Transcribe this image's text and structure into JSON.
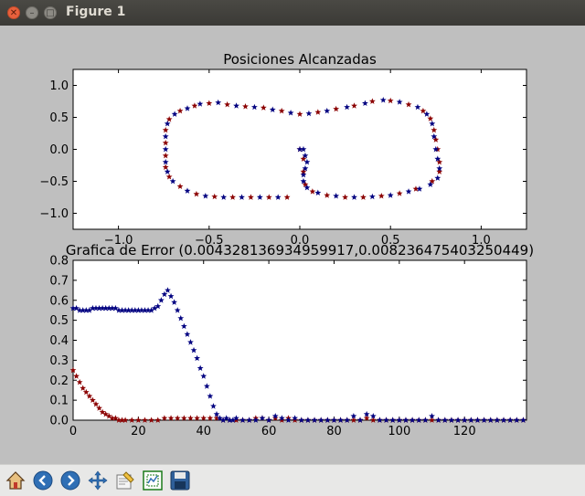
{
  "window": {
    "title": "Figure 1"
  },
  "toolbar": {
    "buttons": [
      {
        "name": "home-icon",
        "tooltip": ""
      },
      {
        "name": "back-icon",
        "tooltip": ""
      },
      {
        "name": "forward-icon",
        "tooltip": ""
      },
      {
        "name": "pan-icon",
        "tooltip": ""
      },
      {
        "name": "zoom-icon",
        "tooltip": ""
      },
      {
        "name": "subplots-icon",
        "tooltip": ""
      },
      {
        "name": "save-icon",
        "tooltip": ""
      }
    ]
  },
  "colors": {
    "series_blue": "#000080",
    "series_red": "#8b0000",
    "background": "#bfbfbf",
    "axes_bg": "#ffffff"
  },
  "chart_data": [
    {
      "type": "scatter",
      "title": "Posiciones Alcanzadas",
      "xlabel": "",
      "ylabel": "",
      "xlim": [
        -1.25,
        1.25
      ],
      "ylim": [
        -1.25,
        1.25
      ],
      "xticks": [
        "−1.0",
        "−0.5",
        "0.0",
        "0.5",
        "1.0"
      ],
      "yticks": [
        "1.0",
        "0.5",
        "0.0",
        "−0.5",
        "−1.0"
      ],
      "grid": false,
      "marker": "star",
      "series": [
        {
          "color": "#000080",
          "points": [
            [
              0.0,
              0.0
            ],
            [
              0.02,
              0.0
            ],
            [
              0.03,
              -0.1
            ],
            [
              0.04,
              -0.2
            ],
            [
              0.03,
              -0.3
            ],
            [
              0.02,
              -0.4
            ],
            [
              0.02,
              -0.5
            ],
            [
              0.04,
              -0.6
            ],
            [
              0.1,
              -0.68
            ],
            [
              0.2,
              -0.73
            ],
            [
              0.3,
              -0.75
            ],
            [
              0.4,
              -0.74
            ],
            [
              0.5,
              -0.72
            ],
            [
              0.6,
              -0.66
            ],
            [
              0.66,
              -0.62
            ],
            [
              0.72,
              -0.55
            ],
            [
              0.76,
              -0.45
            ],
            [
              0.77,
              -0.3
            ],
            [
              0.76,
              -0.15
            ],
            [
              0.75,
              0.0
            ],
            [
              0.74,
              0.2
            ],
            [
              0.73,
              0.4
            ],
            [
              0.7,
              0.55
            ],
            [
              0.65,
              0.66
            ],
            [
              0.55,
              0.74
            ],
            [
              0.46,
              0.77
            ],
            [
              0.36,
              0.72
            ],
            [
              0.26,
              0.66
            ],
            [
              0.15,
              0.6
            ],
            [
              0.05,
              0.56
            ],
            [
              -0.05,
              0.57
            ],
            [
              -0.15,
              0.62
            ],
            [
              -0.25,
              0.66
            ],
            [
              -0.35,
              0.68
            ],
            [
              -0.45,
              0.73
            ],
            [
              -0.55,
              0.71
            ],
            [
              -0.62,
              0.64
            ],
            [
              -0.69,
              0.55
            ],
            [
              -0.73,
              0.4
            ],
            [
              -0.74,
              0.2
            ],
            [
              -0.74,
              0.0
            ],
            [
              -0.74,
              -0.2
            ],
            [
              -0.73,
              -0.35
            ],
            [
              -0.7,
              -0.5
            ],
            [
              -0.62,
              -0.65
            ],
            [
              -0.52,
              -0.73
            ],
            [
              -0.42,
              -0.75
            ],
            [
              -0.32,
              -0.75
            ],
            [
              -0.22,
              -0.75
            ],
            [
              -0.12,
              -0.75
            ]
          ]
        },
        {
          "color": "#8b0000",
          "points": [
            [
              0.0,
              0.0
            ],
            [
              0.02,
              -0.15
            ],
            [
              0.02,
              -0.35
            ],
            [
              0.03,
              -0.55
            ],
            [
              0.07,
              -0.66
            ],
            [
              0.15,
              -0.72
            ],
            [
              0.25,
              -0.75
            ],
            [
              0.35,
              -0.75
            ],
            [
              0.45,
              -0.73
            ],
            [
              0.55,
              -0.69
            ],
            [
              0.64,
              -0.62
            ],
            [
              0.73,
              -0.5
            ],
            [
              0.77,
              -0.35
            ],
            [
              0.77,
              -0.2
            ],
            [
              0.76,
              0.0
            ],
            [
              0.75,
              0.15
            ],
            [
              0.74,
              0.3
            ],
            [
              0.72,
              0.48
            ],
            [
              0.68,
              0.6
            ],
            [
              0.6,
              0.7
            ],
            [
              0.5,
              0.76
            ],
            [
              0.4,
              0.75
            ],
            [
              0.3,
              0.68
            ],
            [
              0.2,
              0.63
            ],
            [
              0.1,
              0.58
            ],
            [
              0.0,
              0.55
            ],
            [
              -0.1,
              0.6
            ],
            [
              -0.2,
              0.65
            ],
            [
              -0.3,
              0.67
            ],
            [
              -0.4,
              0.7
            ],
            [
              -0.5,
              0.72
            ],
            [
              -0.58,
              0.68
            ],
            [
              -0.66,
              0.6
            ],
            [
              -0.72,
              0.47
            ],
            [
              -0.74,
              0.3
            ],
            [
              -0.74,
              0.1
            ],
            [
              -0.74,
              -0.1
            ],
            [
              -0.74,
              -0.28
            ],
            [
              -0.72,
              -0.43
            ],
            [
              -0.66,
              -0.58
            ],
            [
              -0.57,
              -0.7
            ],
            [
              -0.47,
              -0.74
            ],
            [
              -0.37,
              -0.75
            ],
            [
              -0.27,
              -0.75
            ],
            [
              -0.17,
              -0.75
            ],
            [
              -0.07,
              -0.75
            ]
          ]
        }
      ]
    },
    {
      "type": "scatter",
      "title": "Grafica de Error (0.00432813693495991­7,0.00823647540325044­9)",
      "title_display": "Grafica de Error (0.004328136934959917,0.008236475403250449)",
      "xlabel": "",
      "ylabel": "",
      "xlim": [
        0,
        139
      ],
      "ylim": [
        0.0,
        0.8
      ],
      "xticks": [
        "0",
        "20",
        "40",
        "60",
        "80",
        "100",
        "120"
      ],
      "yticks": [
        "0.8",
        "0.7",
        "0.6",
        "0.5",
        "0.4",
        "0.3",
        "0.2",
        "0.1",
        "0.0"
      ],
      "grid": false,
      "marker": "star",
      "series": [
        {
          "color": "#000080",
          "x": [
            0,
            1,
            2,
            3,
            4,
            5,
            6,
            7,
            8,
            9,
            10,
            11,
            12,
            13,
            14,
            15,
            16,
            17,
            18,
            19,
            20,
            21,
            22,
            23,
            24,
            25,
            26,
            27,
            28,
            29,
            30,
            31,
            32,
            33,
            34,
            35,
            36,
            37,
            38,
            39,
            40,
            41,
            42,
            43,
            44,
            45,
            46,
            47,
            48,
            49,
            50,
            52,
            54,
            56,
            58,
            60,
            62,
            64,
            66,
            68,
            70,
            72,
            74,
            76,
            78,
            80,
            82,
            84,
            86,
            88,
            90,
            92,
            94,
            96,
            98,
            100,
            102,
            104,
            106,
            108,
            110,
            112,
            114,
            116,
            118,
            120,
            122,
            124,
            126,
            128,
            130,
            132,
            134,
            136,
            138
          ],
          "y": [
            0.56,
            0.56,
            0.55,
            0.55,
            0.55,
            0.55,
            0.56,
            0.56,
            0.56,
            0.56,
            0.56,
            0.56,
            0.56,
            0.56,
            0.55,
            0.55,
            0.55,
            0.55,
            0.55,
            0.55,
            0.55,
            0.55,
            0.55,
            0.55,
            0.55,
            0.56,
            0.57,
            0.6,
            0.63,
            0.65,
            0.62,
            0.59,
            0.55,
            0.51,
            0.47,
            0.43,
            0.39,
            0.35,
            0.31,
            0.26,
            0.22,
            0.17,
            0.12,
            0.07,
            0.03,
            0.01,
            0.0,
            0.01,
            0.0,
            0.0,
            0.01,
            0.0,
            0.0,
            0.0,
            0.01,
            0.0,
            0.02,
            0.01,
            0.0,
            0.01,
            0.0,
            0.0,
            0.0,
            0.0,
            0.0,
            0.0,
            0.0,
            0.0,
            0.02,
            0.0,
            0.03,
            0.02,
            0.0,
            0.0,
            0.0,
            0.0,
            0.0,
            0.0,
            0.0,
            0.0,
            0.02,
            0.0,
            0.0,
            0.0,
            0.0,
            0.0,
            0.0,
            0.0,
            0.0,
            0.0,
            0.0,
            0.0,
            0.0,
            0.0,
            0.0
          ]
        },
        {
          "color": "#8b0000",
          "x": [
            0,
            1,
            2,
            3,
            4,
            5,
            6,
            7,
            8,
            9,
            10,
            11,
            12,
            13,
            14,
            15,
            16,
            18,
            20,
            22,
            24,
            26,
            28,
            30,
            32,
            34,
            36,
            38,
            40,
            42,
            44,
            46,
            48,
            50,
            52,
            54,
            56,
            58,
            60,
            62,
            64,
            66,
            68,
            70,
            72,
            74,
            76,
            78,
            80,
            82,
            84,
            86,
            88,
            90,
            92,
            94,
            96,
            98,
            100,
            102,
            104,
            106,
            108,
            110,
            112,
            114,
            116,
            118,
            120,
            122,
            124,
            126,
            128,
            130,
            132,
            134,
            136,
            138
          ],
          "y": [
            0.25,
            0.22,
            0.19,
            0.16,
            0.14,
            0.12,
            0.1,
            0.08,
            0.06,
            0.04,
            0.03,
            0.02,
            0.01,
            0.01,
            0.0,
            0.0,
            0.0,
            0.0,
            0.0,
            0.0,
            0.0,
            0.0,
            0.01,
            0.01,
            0.01,
            0.01,
            0.01,
            0.01,
            0.01,
            0.01,
            0.01,
            0.0,
            0.0,
            0.0,
            0.0,
            0.0,
            0.01,
            0.01,
            0.0,
            0.01,
            0.0,
            0.01,
            0.0,
            0.0,
            0.0,
            0.0,
            0.0,
            0.0,
            0.0,
            0.0,
            0.0,
            0.0,
            0.0,
            0.01,
            0.0,
            0.0,
            0.0,
            0.0,
            0.0,
            0.0,
            0.0,
            0.0,
            0.0,
            0.0,
            0.0,
            0.0,
            0.0,
            0.0,
            0.0,
            0.0,
            0.0,
            0.0,
            0.0,
            0.0,
            0.0,
            0.0,
            0.0,
            0.0
          ]
        }
      ]
    }
  ]
}
